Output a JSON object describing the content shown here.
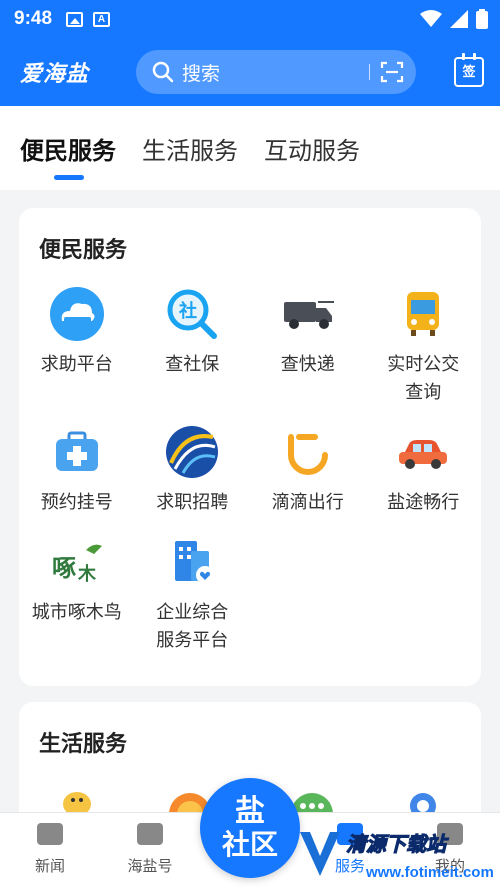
{
  "status": {
    "time": "9:48"
  },
  "header": {
    "logo": "爱海盐",
    "search_placeholder": "搜索",
    "sign_label": "签"
  },
  "tabs": [
    {
      "label": "便民服务",
      "active": true
    },
    {
      "label": "生活服务",
      "active": false
    },
    {
      "label": "互动服务",
      "active": false
    }
  ],
  "section1": {
    "title": "便民服务",
    "items": [
      {
        "label": "求助平台",
        "icon": "cloud-help-icon"
      },
      {
        "label": "查社保",
        "icon": "social-security-search-icon"
      },
      {
        "label": "查快递",
        "icon": "delivery-truck-icon"
      },
      {
        "label": "实时公交\n查询",
        "icon": "bus-icon"
      },
      {
        "label": "预约挂号",
        "icon": "medical-kit-icon"
      },
      {
        "label": "求职招聘",
        "icon": "job-globe-icon"
      },
      {
        "label": "滴滴出行",
        "icon": "didi-icon"
      },
      {
        "label": "盐途畅行",
        "icon": "car-icon"
      },
      {
        "label": "城市啄木鸟",
        "icon": "woodpecker-icon"
      },
      {
        "label": "企业综合\n服务平台",
        "icon": "enterprise-building-icon"
      }
    ]
  },
  "section2": {
    "title": "生活服务"
  },
  "nav": {
    "items": [
      {
        "label": "新闻"
      },
      {
        "label": "海盐号"
      },
      {
        "label": "服务"
      },
      {
        "label": "我的"
      }
    ],
    "center_line1": "盐",
    "center_line2": "社区"
  },
  "watermark": {
    "line1": "清源下载站",
    "line2": "www.fotimeit.com"
  },
  "colors": {
    "primary": "#1677ff",
    "background": "#f3f4f6"
  }
}
